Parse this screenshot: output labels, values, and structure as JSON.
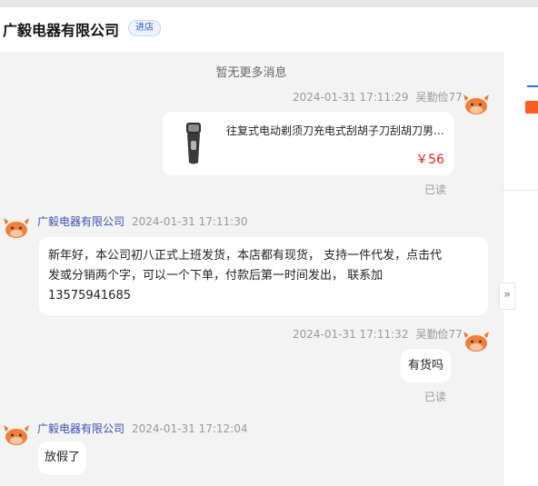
{
  "header": {
    "shop_name": "广毅电器有限公司",
    "enter_shop": "进店"
  },
  "chat": {
    "no_more": "暂无更多消息",
    "messages": [
      {
        "side": "right",
        "sender": "吴勤俭77",
        "time": "2024-01-31 17:11:29",
        "product": {
          "title": "往复式电动剃须刀充电式刮胡子刀刮胡刀男...",
          "price": "￥56"
        },
        "status": "已读"
      },
      {
        "side": "left",
        "sender": "广毅电器有限公司",
        "time": "2024-01-31 17:11:30",
        "text_lines": [
          "新年好，本公司初八正式上班发货，本店都有现货， 支持一件代发，点击代",
          "发或分销两个字，可以一个下单，付款后第一时间发出， 联系加",
          "13575941685"
        ]
      },
      {
        "side": "right",
        "sender": "吴勤俭77",
        "time": "2024-01-31 17:11:32",
        "text": "有货吗",
        "status": "已读"
      },
      {
        "side": "left",
        "sender": "广毅电器有限公司",
        "time": "2024-01-31 17:12:04",
        "text": "放假了"
      }
    ]
  },
  "colors": {
    "price": "#e0231c",
    "sender_link": "#3b4fb2",
    "accent": "#2c6fdf"
  }
}
